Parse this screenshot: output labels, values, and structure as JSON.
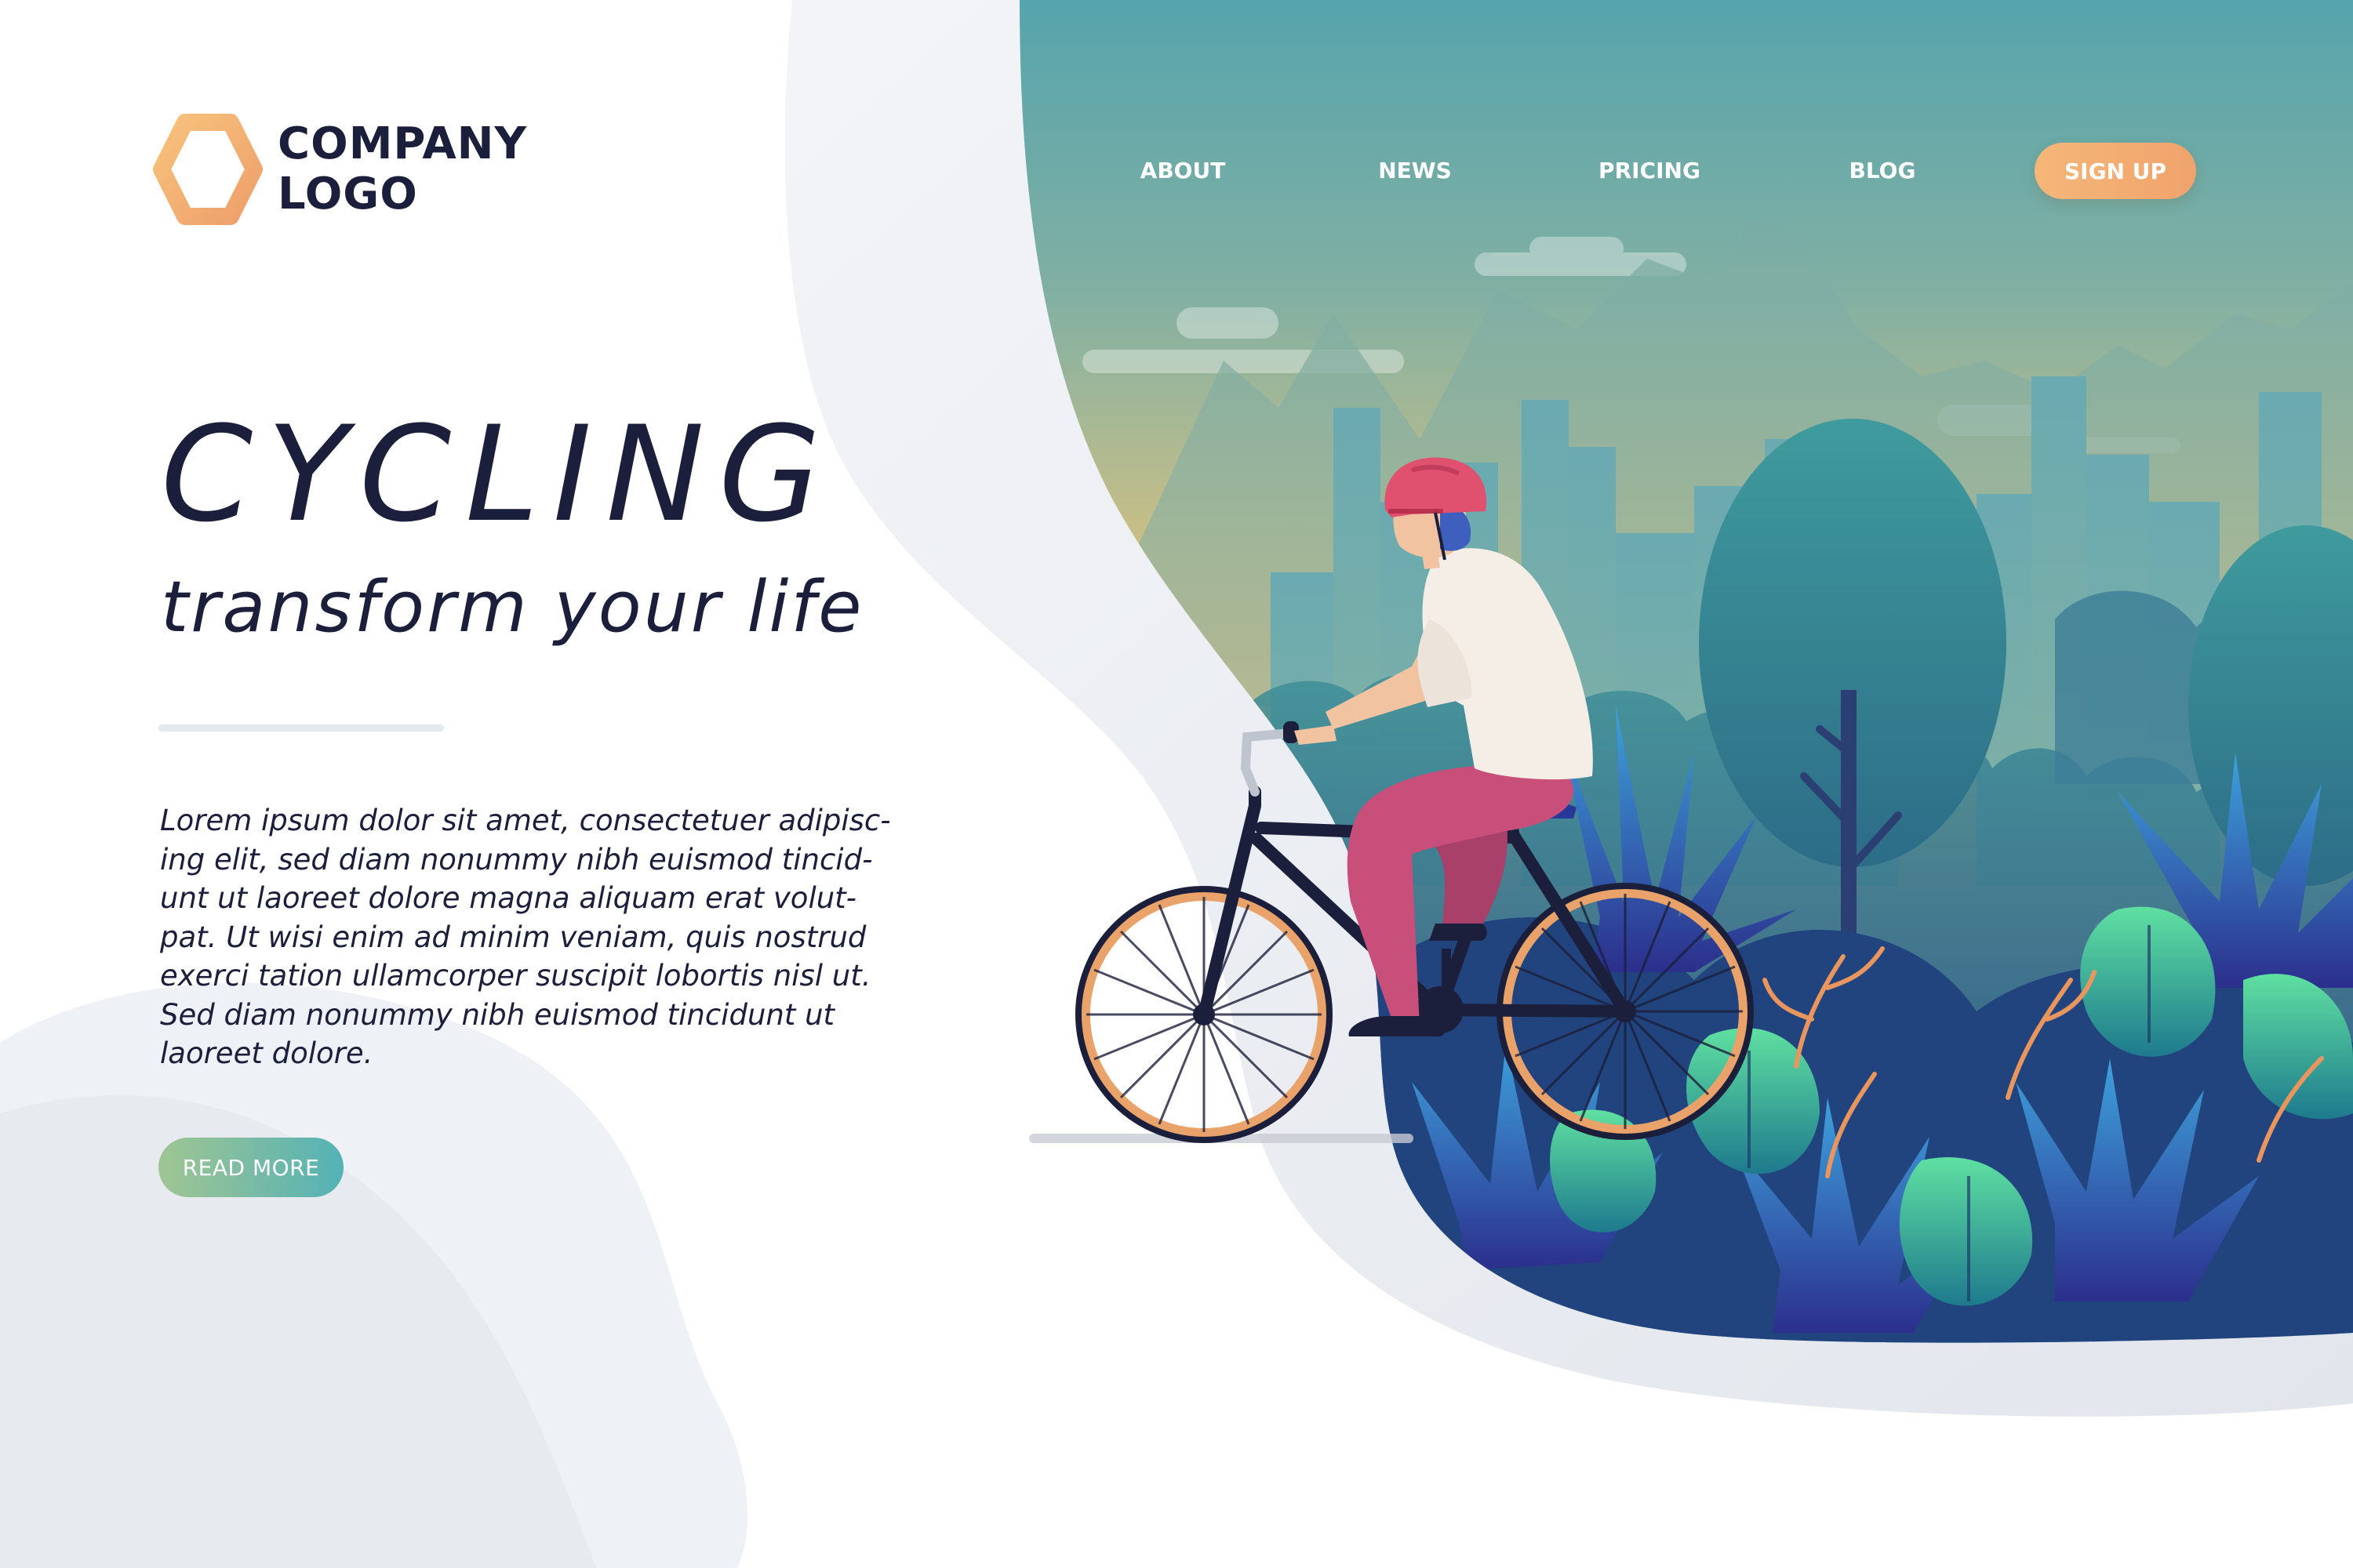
{
  "brand": {
    "logo_line1": "COMPANY",
    "logo_line2": "LOGO",
    "logo_icon": "hexagon-icon",
    "logo_colors": [
      "#f7c27c",
      "#ee9f6b"
    ]
  },
  "nav": {
    "items": [
      {
        "label": "ABOUT"
      },
      {
        "label": "NEWS"
      },
      {
        "label": "PRICING"
      },
      {
        "label": "BLOG"
      }
    ],
    "signup_label": "SIGN UP"
  },
  "hero": {
    "title": "CYCLING",
    "subtitle": "transform your life",
    "body_lines": [
      "Lorem ipsum dolor sit amet, consectetuer adipisc-",
      "ing elit, sed diam nonummy nibh euismod tincid-",
      "unt ut laoreet dolore magna aliquam erat volut-",
      "pat. Ut wisi enim ad minim veniam, quis nostrud",
      "exerci tation ullamcorper suscipit lobortis nisl ut.",
      "Sed diam nonummy nibh euismod tincidunt ut",
      "laoreet dolore."
    ],
    "cta_label": "READ MORE"
  },
  "colors": {
    "text_dark": "#1b1f3b",
    "accent_orange": "#f0a36c",
    "accent_teal": "#54b2b6",
    "helmet": "#e0506f",
    "pants": "#c84f79"
  },
  "illustration": {
    "subject": "cyclist-riding-bicycle",
    "background": "city-skyline-mountains-forest"
  }
}
